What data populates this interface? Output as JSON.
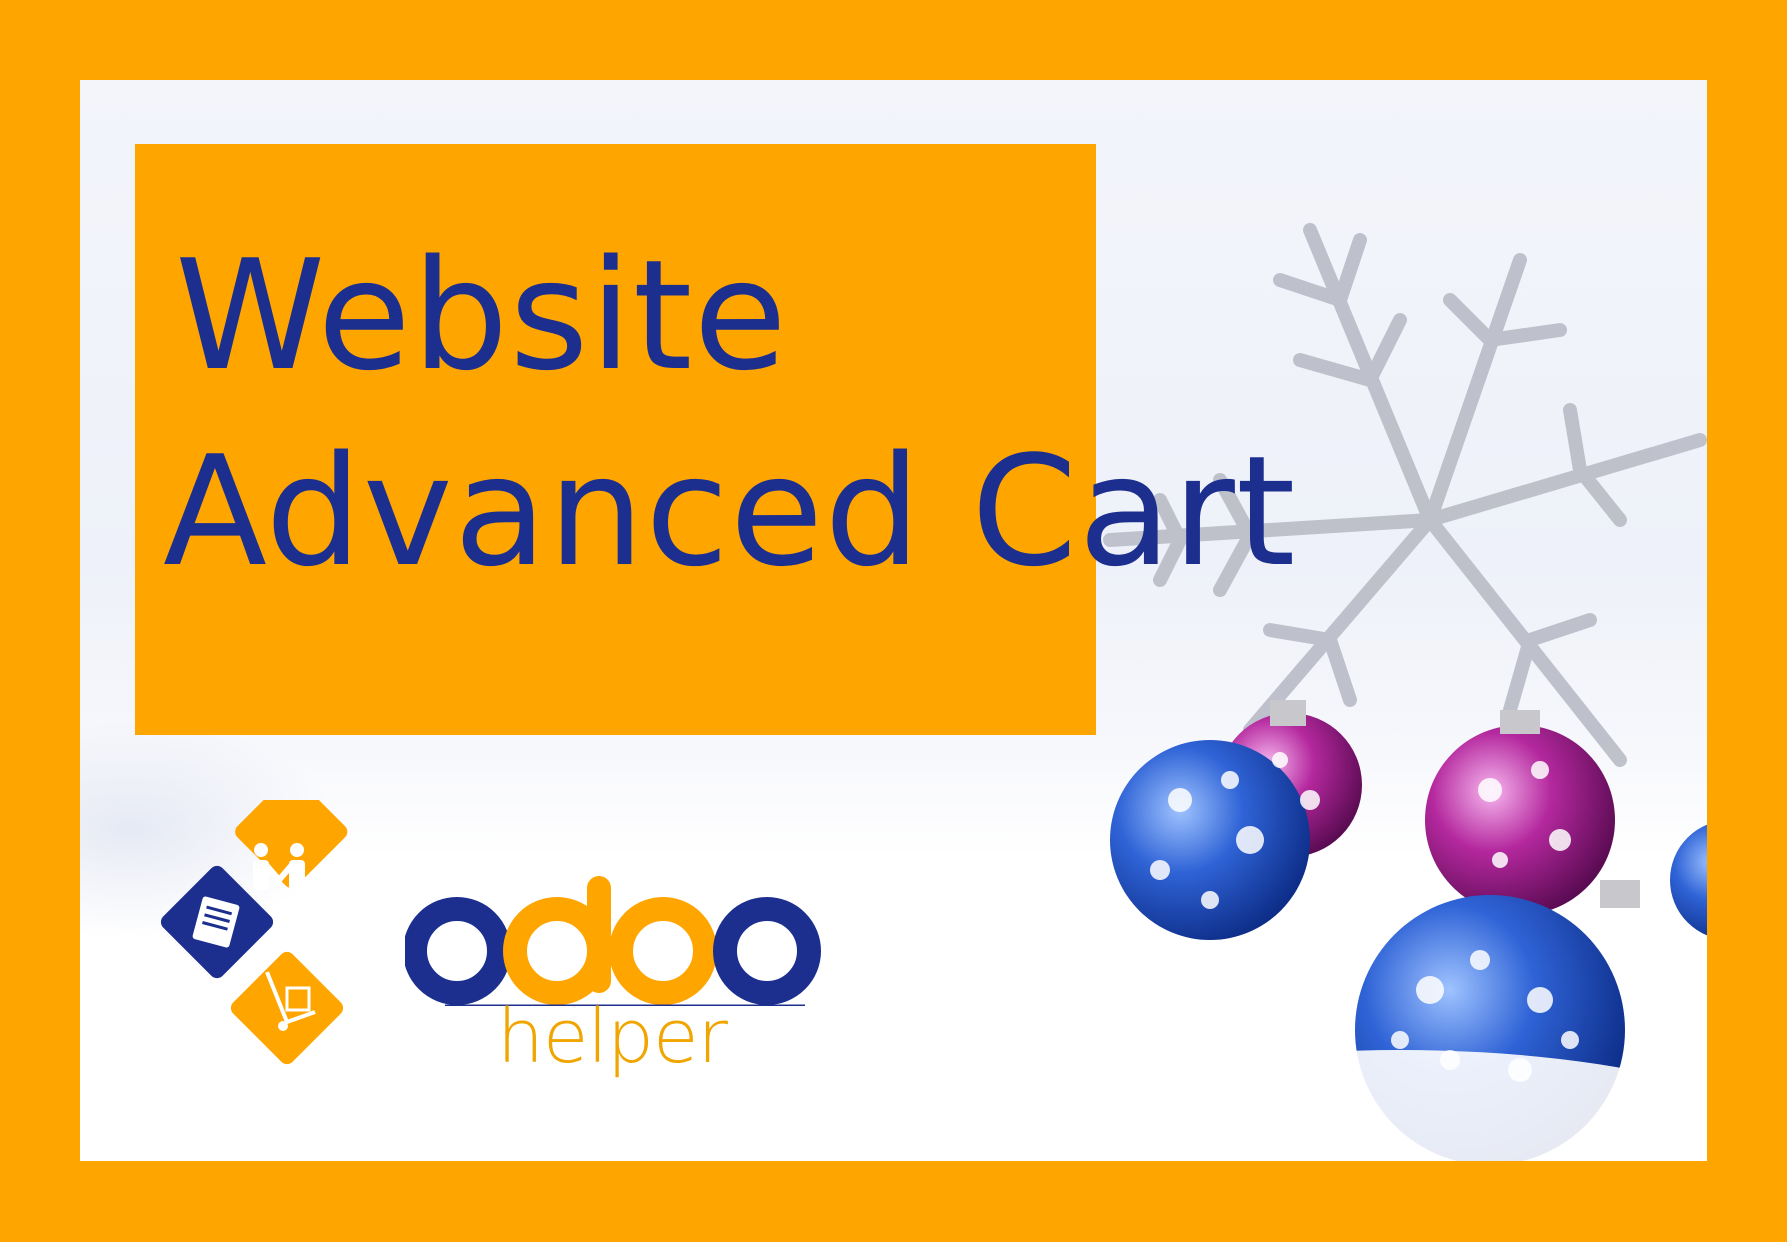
{
  "banner": {
    "title_line_1": "Website",
    "title_line_2": "Advanced Cart"
  },
  "logo": {
    "wordmark": "odoo",
    "tagline": "helper"
  },
  "colors": {
    "frame": "#FFA500",
    "title_box": "#FFA500",
    "title_text": "#1c2f8f",
    "logo_blue": "#1c2f8f",
    "logo_orange": "#FFA500"
  },
  "icons": [
    "people-icon",
    "book-icon",
    "hand-truck-icon",
    "snowflake-decoration",
    "christmas-ornament"
  ]
}
